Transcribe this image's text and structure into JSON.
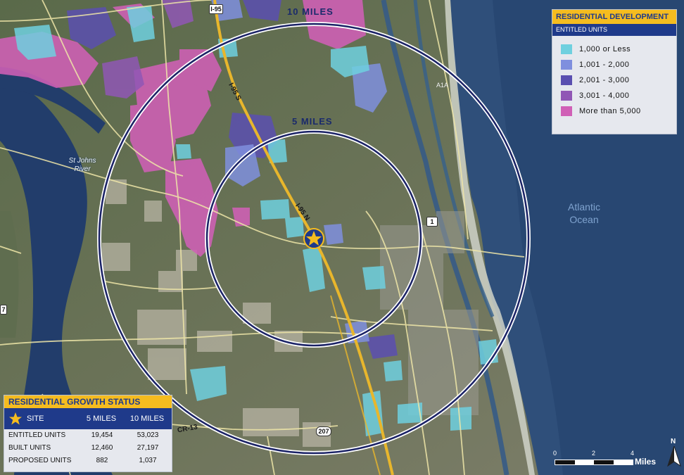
{
  "map": {
    "ring_labels": {
      "outer": "10 MILES",
      "inner": "5 MILES"
    },
    "road_labels": [
      "I-95",
      "I-95 S",
      "I-95 N",
      "A1A",
      "1",
      "207",
      "CR-13",
      "7"
    ],
    "water_labels": {
      "river": "St Johns\nRiver",
      "ocean": "Atlantic\nOcean"
    }
  },
  "legend": {
    "title": "RESIDENTIAL DEVELOPMENT",
    "subtitle": "ENTITLED UNITS",
    "items": [
      {
        "label": "1,000 or Less",
        "color": "#6fd0df"
      },
      {
        "label": "1,001 - 2,000",
        "color": "#7f8fde"
      },
      {
        "label": "2,001 - 3,000",
        "color": "#5a4fb0"
      },
      {
        "label": "3,001 - 4,000",
        "color": "#9057b5"
      },
      {
        "label": "More than 5,000",
        "color": "#d060b6"
      }
    ]
  },
  "status": {
    "title": "RESIDENTIAL GROWTH STATUS",
    "columns": {
      "site": "SITE",
      "five": "5 MILES",
      "ten": "10 MILES"
    },
    "rows": [
      {
        "label": "ENTITLED UNITS",
        "five": "19,454",
        "ten": "53,023"
      },
      {
        "label": "BUILT UNITS",
        "five": "12,460",
        "ten": "27,197"
      },
      {
        "label": "PROPOSED UNITS",
        "five": "882",
        "ten": "1,037"
      }
    ]
  },
  "scale": {
    "ticks": [
      "0",
      "2",
      "4"
    ],
    "unit": "Miles"
  },
  "north_arrow": {
    "label": "N"
  },
  "colors": {
    "accent_gold": "#f5bc1f",
    "brand_navy": "#1f3a8a",
    "ring": "#1a2266"
  }
}
